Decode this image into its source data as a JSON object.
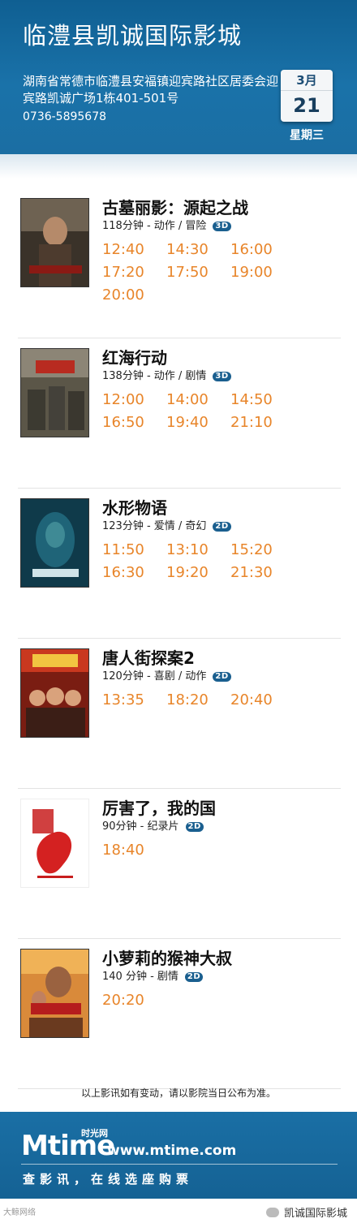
{
  "header": {
    "title": "临澧县凯诚国际影城",
    "address": "湖南省常德市临澧县安福镇迎宾路社区居委会迎宾路凯诚广场1栋401-501号",
    "phone": "0736-5895678",
    "date_month": "3月",
    "date_day": "21",
    "weekday": "星期三"
  },
  "movies": [
    {
      "title": "古墓丽影：源起之战",
      "meta": "118分钟 - 动作 / 冒险",
      "format": "3D",
      "times": [
        "12:40",
        "14:30",
        "16:00",
        "17:20",
        "17:50",
        "19:00",
        "20:00"
      ]
    },
    {
      "title": "红海行动",
      "meta": "138分钟 - 动作 / 剧情",
      "format": "3D",
      "times": [
        "12:00",
        "14:00",
        "14:50",
        "16:50",
        "19:40",
        "21:10"
      ]
    },
    {
      "title": "水形物语",
      "meta": "123分钟 - 爱情 / 奇幻",
      "format": "2D",
      "times": [
        "11:50",
        "13:10",
        "15:20",
        "16:30",
        "19:20",
        "21:30"
      ]
    },
    {
      "title": "唐人街探案2",
      "meta": "120分钟 - 喜剧 / 动作",
      "format": "2D",
      "times": [
        "13:35",
        "18:20",
        "20:40"
      ]
    },
    {
      "title": "厉害了，我的国",
      "meta": "90分钟 - 纪录片",
      "format": "2D",
      "times": [
        "18:40"
      ]
    },
    {
      "title": "小萝莉的猴神大叔",
      "meta": "140 分钟 - 剧情",
      "format": "2D",
      "times": [
        "20:20"
      ]
    }
  ],
  "notice": "以上影讯如有变动，请以影院当日公布为准。",
  "footer": {
    "logo": "Mtime",
    "logo_sub": "时光网",
    "url": "www.mtime.com",
    "slogan": "查影讯，在线选座购票",
    "watermark_left": "大鲸网络",
    "watermark_right": "凯诚国际影城"
  },
  "colors": {
    "header_blue": "#1a72a9",
    "time_orange": "#e8852a"
  }
}
